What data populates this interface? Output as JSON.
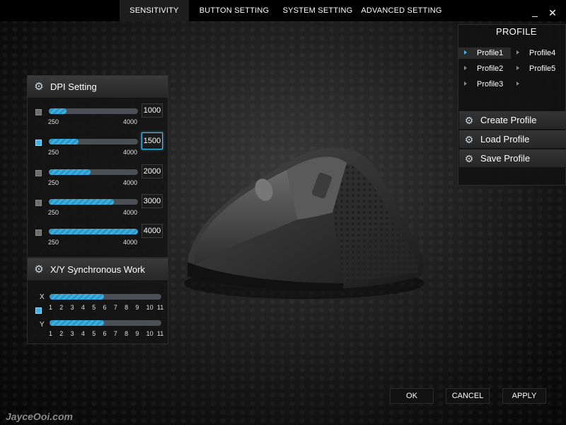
{
  "tabs": [
    {
      "label": "SENSITIVITY",
      "active": true
    },
    {
      "label": "BUTTON SETTING",
      "active": false
    },
    {
      "label": "SYSTEM SETTING",
      "active": false
    },
    {
      "label": "ADVANCED SETTING",
      "active": false
    }
  ],
  "window": {
    "minimize": "_",
    "close": "✕"
  },
  "dpi": {
    "title": "DPI Setting",
    "min_label": "250",
    "max_label": "4000",
    "min": 250,
    "max": 4000,
    "levels": [
      {
        "value": "1000",
        "enabled": false,
        "selected": false
      },
      {
        "value": "1500",
        "enabled": true,
        "selected": true
      },
      {
        "value": "2000",
        "enabled": false,
        "selected": false
      },
      {
        "value": "3000",
        "enabled": false,
        "selected": false
      },
      {
        "value": "4000",
        "enabled": false,
        "selected": false
      }
    ]
  },
  "xy": {
    "title": "X/Y Synchronous Work",
    "sync_enabled": true,
    "x_label": "X",
    "y_label": "Y",
    "x_value": 6,
    "y_value": 6,
    "max": 11,
    "scale": [
      "1",
      "2",
      "3",
      "4",
      "5",
      "6",
      "7",
      "8",
      "9",
      "10",
      "11"
    ]
  },
  "profile": {
    "title": "PROFILE",
    "items": [
      {
        "label": "Profile1",
        "active": true
      },
      {
        "label": "Profile4",
        "active": false
      },
      {
        "label": "Profile2",
        "active": false
      },
      {
        "label": "Profile5",
        "active": false
      },
      {
        "label": "Profile3",
        "active": false
      },
      {
        "label": "",
        "active": false
      }
    ],
    "actions": [
      "Create Profile",
      "Load Profile",
      "Save Profile"
    ]
  },
  "buttons": {
    "ok": "OK",
    "cancel": "CANCEL",
    "apply": "APPLY"
  },
  "watermark": "JayceOoi.com",
  "icons": {
    "gear": "gear-icon",
    "arrow": "arrow-right-icon"
  },
  "colors": {
    "accent": "#3fb4e6",
    "background": "#111111"
  }
}
